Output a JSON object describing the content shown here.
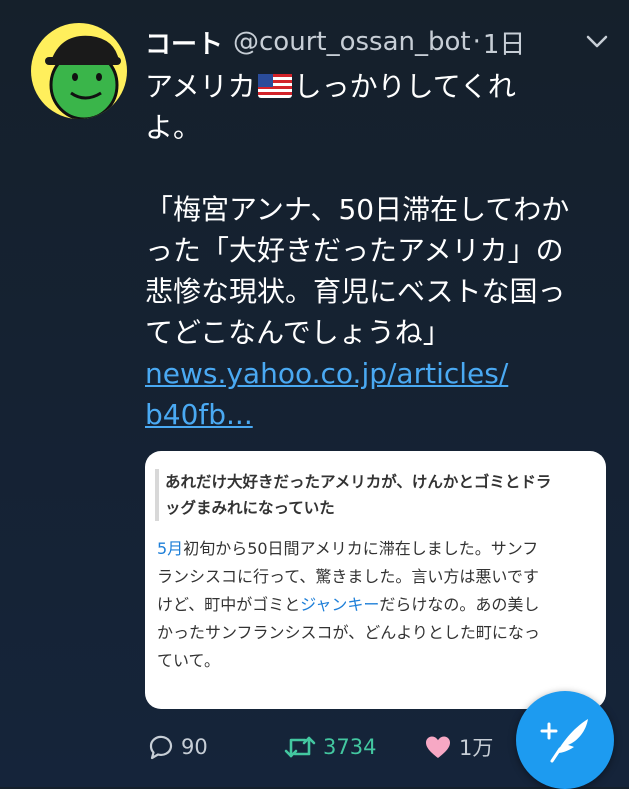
{
  "tweet": {
    "display_name": "コート",
    "handle": "@court_ossan_bot",
    "separator": "·",
    "time": "1日",
    "text_line1_a": "アメリカ",
    "text_line1_b": "しっかりしてくれ",
    "text_line2": "よ。",
    "quote_line1": "「梅宮アンナ、50日滞在してわか",
    "quote_line2": "った「大好きだったアメリカ」の",
    "quote_line3": "悲惨な現状。育児にベストな国っ",
    "quote_line4": "てどこなんでしょうね」",
    "link_line1": "news.yahoo.co.jp/articles/",
    "link_line2": "b40fb..."
  },
  "card": {
    "headline_line1": "あれだけ大好きだったアメリカが、けんかとゴミとドラ",
    "headline_line2": "ッグまみれになっていた",
    "body_line1_a": "5月",
    "body_line1_b": "初旬から50日間アメリカに滞在しました。サンフ",
    "body_line2": "ランシスコに行って、驚きました。言い方は悪いです",
    "body_line3_a": "けど、町中がゴミと",
    "body_line3_link": "ジャンキー",
    "body_line3_b": "だらけなの。あの美し",
    "body_line4": "かったサンフランシスコが、どんよりとした町になっ",
    "body_line5": "ていて。"
  },
  "actions": {
    "reply_count": "90",
    "retweet_count": "3734",
    "like_count": "1万"
  },
  "colors": {
    "background": "#15202b",
    "link": "#4aa9f2",
    "retweet": "#43c7a0",
    "like": "#f7a8c4",
    "fab": "#1d9bf0"
  },
  "icons": {
    "caret": "chevron-down-icon",
    "flag": "us-flag-emoji",
    "reply": "reply-icon",
    "retweet": "retweet-icon",
    "like": "heart-icon",
    "compose": "compose-tweet-icon"
  }
}
